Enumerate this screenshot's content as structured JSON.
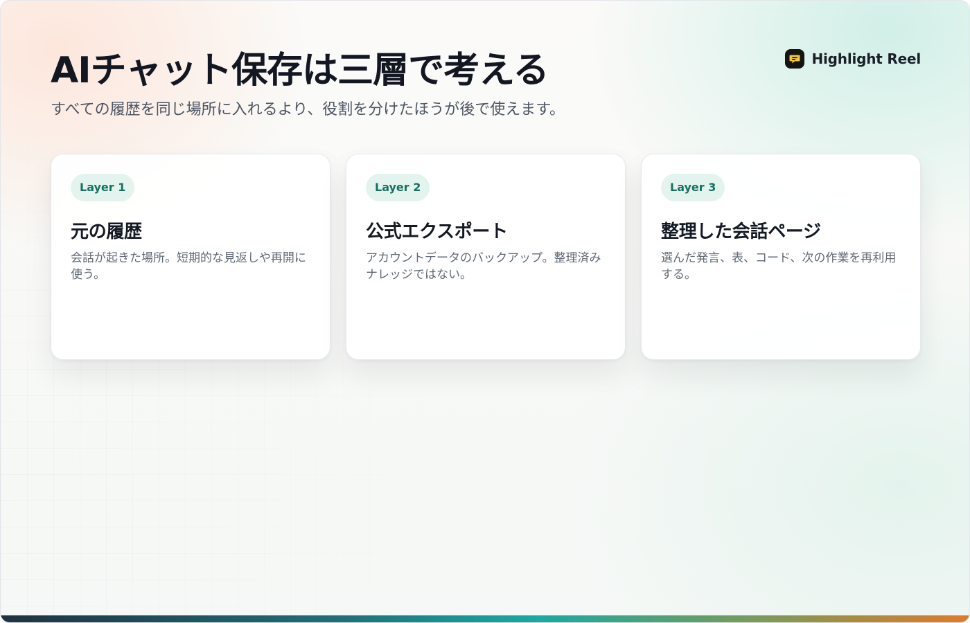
{
  "header": {
    "title": "AIチャット保存は三層で考える",
    "subtitle": "すべての履歴を同じ場所に入れるより、役割を分けたほうが後で使えます。"
  },
  "brand": {
    "name": "Highlight Reel",
    "icon": "chat-bubble-icon"
  },
  "cards": [
    {
      "badge": "Layer 1",
      "title": "元の履歴",
      "description": "会話が起きた場所。短期的な見返しや再開に使う。"
    },
    {
      "badge": "Layer 2",
      "title": "公式エクスポート",
      "description": "アカウントデータのバックアップ。整理済みナレッジではない。"
    },
    {
      "badge": "Layer 3",
      "title": "整理した会話ページ",
      "description": "選んだ発言、表、コード、次の作業を再利用する。"
    }
  ],
  "colors": {
    "accent": "#157060",
    "badge_bg": "#e3f4ef",
    "title": "#121722",
    "bar_start": "#1f3140",
    "bar_mid": "#1aa9a2",
    "bar_end": "#e07a2a"
  }
}
